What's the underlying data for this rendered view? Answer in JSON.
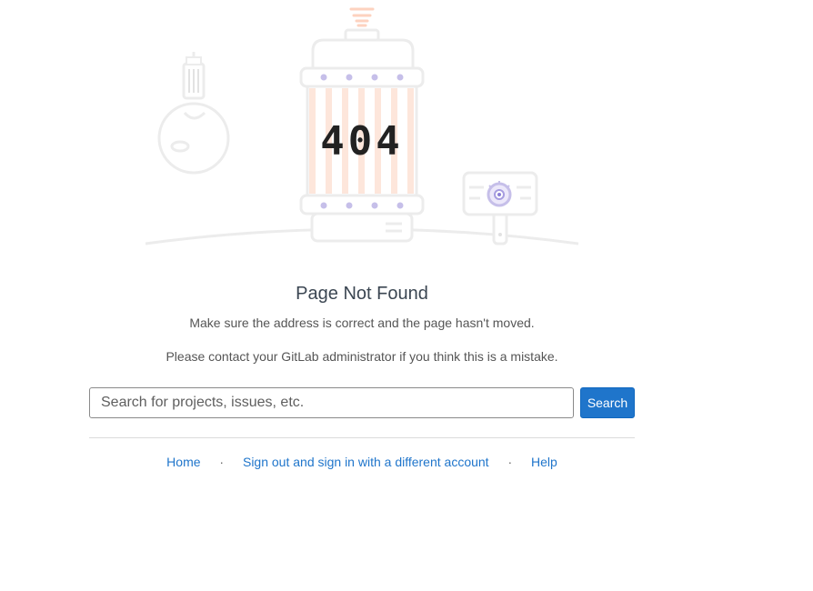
{
  "illustration": {
    "code": "404"
  },
  "content": {
    "title": "Page Not Found",
    "message_primary": "Make sure the address is correct and the page hasn't moved.",
    "message_secondary": "Please contact your GitLab administrator if you think this is a mistake."
  },
  "search": {
    "placeholder": "Search for projects, issues, etc.",
    "value": "",
    "button_label": "Search"
  },
  "footer_links": {
    "home": "Home",
    "sign_out": "Sign out and sign in with a different account",
    "help": "Help",
    "separator": "·"
  },
  "colors": {
    "accent": "#1f75cb",
    "title": "#3b4652",
    "illustration_gray": "#eeeeee",
    "illustration_purple": "#c6bfe9",
    "illustration_orange": "#fdd7c5"
  }
}
